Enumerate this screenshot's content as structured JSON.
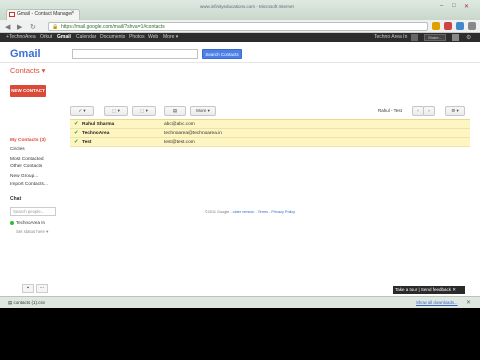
{
  "browser": {
    "tab_title": "Gmail - Contact Manager",
    "window_title": "www.infinityeducations.com - Microsoft Internet",
    "url": "https://mail.google.com/mail/?shva=1#contacts"
  },
  "google_bar": {
    "items": [
      "+TechnoArea",
      "Orkut",
      "Gmail",
      "Calendar",
      "Documents",
      "Photos",
      "Web",
      "More ▾"
    ],
    "active": "Gmail",
    "user": "Techno Area In",
    "share_label": "Share..."
  },
  "header": {
    "logo": "Gmail",
    "search_button": "Search Contacts"
  },
  "sidebar": {
    "title": "Contacts ▾",
    "new_contact": "NEW CONTACT",
    "items": [
      {
        "label": "My Contacts (3)"
      },
      {
        "label": "Circles"
      },
      {
        "label": "Most Contacted"
      },
      {
        "label": "Other Contacts"
      },
      {
        "label": "New Group..."
      },
      {
        "label": "Import Contacts..."
      }
    ],
    "chat_title": "Chat",
    "chat_search_placeholder": "Search people...",
    "chat_user": "TechnoArea In",
    "chat_status": "Set status here ▾"
  },
  "actions": {
    "select": "✓ ▾",
    "add_to_circle": "⬚ ▾",
    "groups": "⬚ ▾",
    "trash": "▤",
    "more": "More ▾",
    "sort_label": "Rahul - Test",
    "prev": "‹",
    "next": "›",
    "settings": "⚙ ▾"
  },
  "contacts": [
    {
      "name": "Rahul Sharma",
      "email": "abc@abc.com"
    },
    {
      "name": "TechnoArea",
      "email": "technoarea@technoarea.in"
    },
    {
      "name": "Test",
      "email": "test@test.com"
    }
  ],
  "footer": {
    "copyright": "©2011 Google - ",
    "links": [
      "Terms",
      "Privacy Policy"
    ],
    "old_version": "older version"
  },
  "feedback_label": "Take a tour | Send feedback ✕",
  "downloads": {
    "item": "contacts (1).csv",
    "show_all": "Show all downloads..."
  },
  "colors": {
    "gmail_red": "#dd4b39",
    "highlight": "#fdf5c2",
    "search_blue": "#4d7fe8"
  }
}
